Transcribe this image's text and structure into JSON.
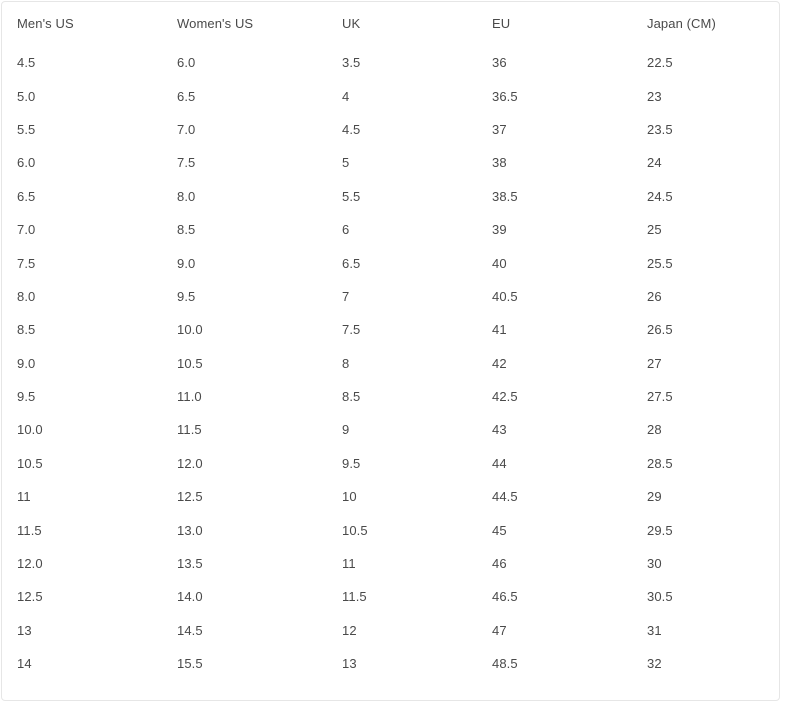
{
  "table": {
    "caption": "",
    "columns": [
      {
        "key": "mens_us",
        "label": "Men's US"
      },
      {
        "key": "womens_us",
        "label": "Women's US"
      },
      {
        "key": "uk",
        "label": "UK"
      },
      {
        "key": "eu",
        "label": "EU"
      },
      {
        "key": "japan_cm",
        "label": "Japan (CM)"
      }
    ],
    "rows": [
      [
        "4.5",
        "6.0",
        "3.5",
        "36",
        "22.5"
      ],
      [
        "5.0",
        "6.5",
        "4",
        "36.5",
        "23"
      ],
      [
        "5.5",
        "7.0",
        "4.5",
        "37",
        "23.5"
      ],
      [
        "6.0",
        "7.5",
        "5",
        "38",
        "24"
      ],
      [
        "6.5",
        "8.0",
        "5.5",
        "38.5",
        "24.5"
      ],
      [
        "7.0",
        "8.5",
        "6",
        "39",
        "25"
      ],
      [
        "7.5",
        "9.0",
        "6.5",
        "40",
        "25.5"
      ],
      [
        "8.0",
        "9.5",
        "7",
        "40.5",
        "26"
      ],
      [
        "8.5",
        "10.0",
        "7.5",
        "41",
        "26.5"
      ],
      [
        "9.0",
        "10.5",
        "8",
        "42",
        "27"
      ],
      [
        "9.5",
        "11.0",
        "8.5",
        "42.5",
        "27.5"
      ],
      [
        "10.0",
        "11.5",
        "9",
        "43",
        "28"
      ],
      [
        "10.5",
        "12.0",
        "9.5",
        "44",
        "28.5"
      ],
      [
        "11",
        "12.5",
        "10",
        "44.5",
        "29"
      ],
      [
        "11.5",
        "13.0",
        "10.5",
        "45",
        "29.5"
      ],
      [
        "12.0",
        "13.5",
        "11",
        "46",
        "30"
      ],
      [
        "12.5",
        "14.0",
        "11.5",
        "46.5",
        "30.5"
      ],
      [
        "13",
        "14.5",
        "12",
        "47",
        "31"
      ],
      [
        "14",
        "15.5",
        "13",
        "48.5",
        "32"
      ]
    ]
  },
  "colors": {
    "text": "#4a4a4a",
    "border": "#e6e6e6",
    "background": "#ffffff"
  }
}
